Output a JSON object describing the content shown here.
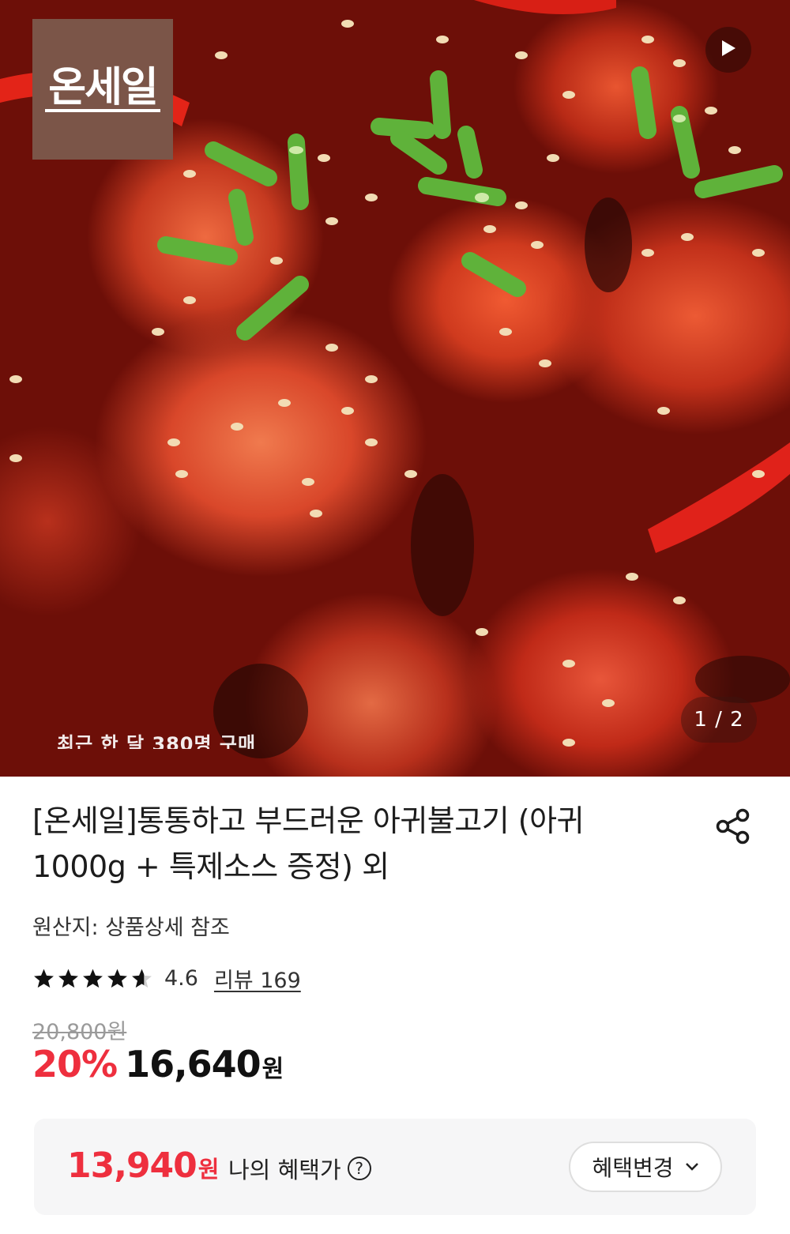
{
  "hero": {
    "brand_logo": "온세일",
    "play_icon": "play-icon",
    "caption_hint": "최근 한 달 380명 구매",
    "page_indicator": "1 / 2"
  },
  "product": {
    "title_line1": "[온세일]통통하고 부드러운 아귀불고기 (아귀",
    "title_line2": "1000g + 특제소스 증정) 외",
    "origin": "원산지: 상품상세 참조",
    "rating": "4.6",
    "rating_stars": 4.6,
    "review_link": "리뷰 169",
    "original_price": "20,800원",
    "discount": "20%",
    "sale_price": "16,640",
    "sale_unit": "원"
  },
  "benefit": {
    "amount": "13,940",
    "unit": "원",
    "label": "나의 혜택가",
    "change_button": "혜택변경"
  },
  "colors": {
    "accent_red": "#ee2f3e",
    "brand_logo_bg": "#7b5548"
  },
  "icons": [
    "play-icon",
    "share-icon",
    "star-icon",
    "help-icon",
    "chevron-down-icon"
  ]
}
